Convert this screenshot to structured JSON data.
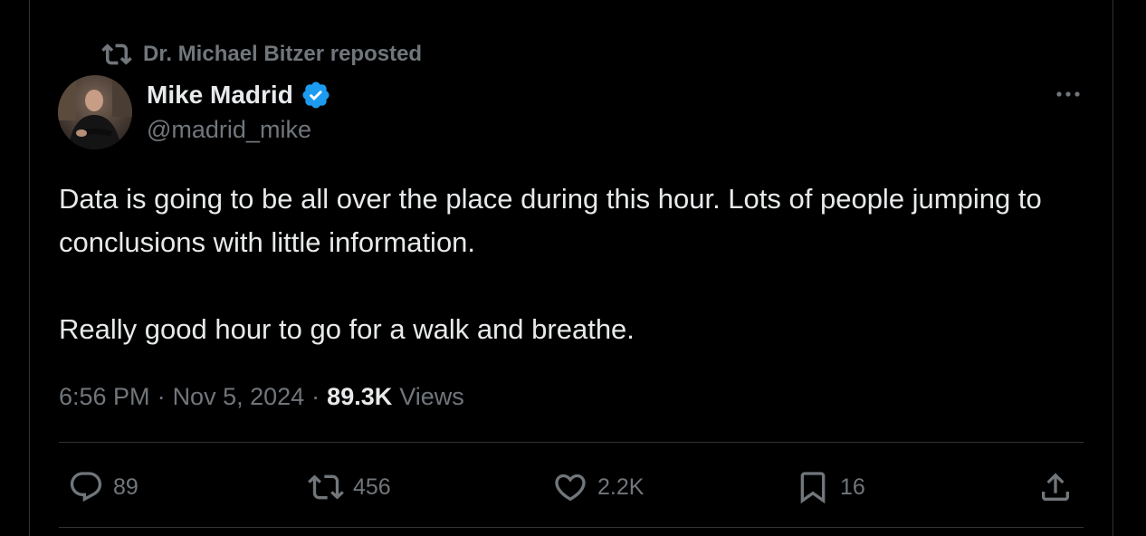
{
  "repost_banner": {
    "text": "Dr. Michael Bitzer reposted",
    "icon": "repost-icon"
  },
  "author": {
    "display_name": "Mike Madrid",
    "handle": "@madrid_mike",
    "verified": true,
    "verified_color": "#1d9bf0",
    "avatar_icon": "avatar"
  },
  "tweet": {
    "paragraphs": [
      "Data is going to be all over the place during this hour. Lots of people jumping to conclusions with little information.",
      "Really good hour to go for a walk and breathe."
    ]
  },
  "meta": {
    "time": "6:56 PM",
    "separator": "·",
    "date": "Nov 5, 2024",
    "views_count": "89.3K",
    "views_label": "Views"
  },
  "actions": {
    "reply": {
      "icon": "reply-icon",
      "count": "89"
    },
    "repost": {
      "icon": "repost-icon",
      "count": "456"
    },
    "like": {
      "icon": "heart-icon",
      "count": "2.2K"
    },
    "bookmark": {
      "icon": "bookmark-icon",
      "count": "16"
    },
    "share": {
      "icon": "share-icon"
    }
  },
  "more_menu": {
    "icon": "more-icon"
  },
  "colors": {
    "background": "#000000",
    "text_primary": "#e7e9ea",
    "text_secondary": "#71767b",
    "border": "#2f3336",
    "verified_blue": "#1d9bf0"
  }
}
